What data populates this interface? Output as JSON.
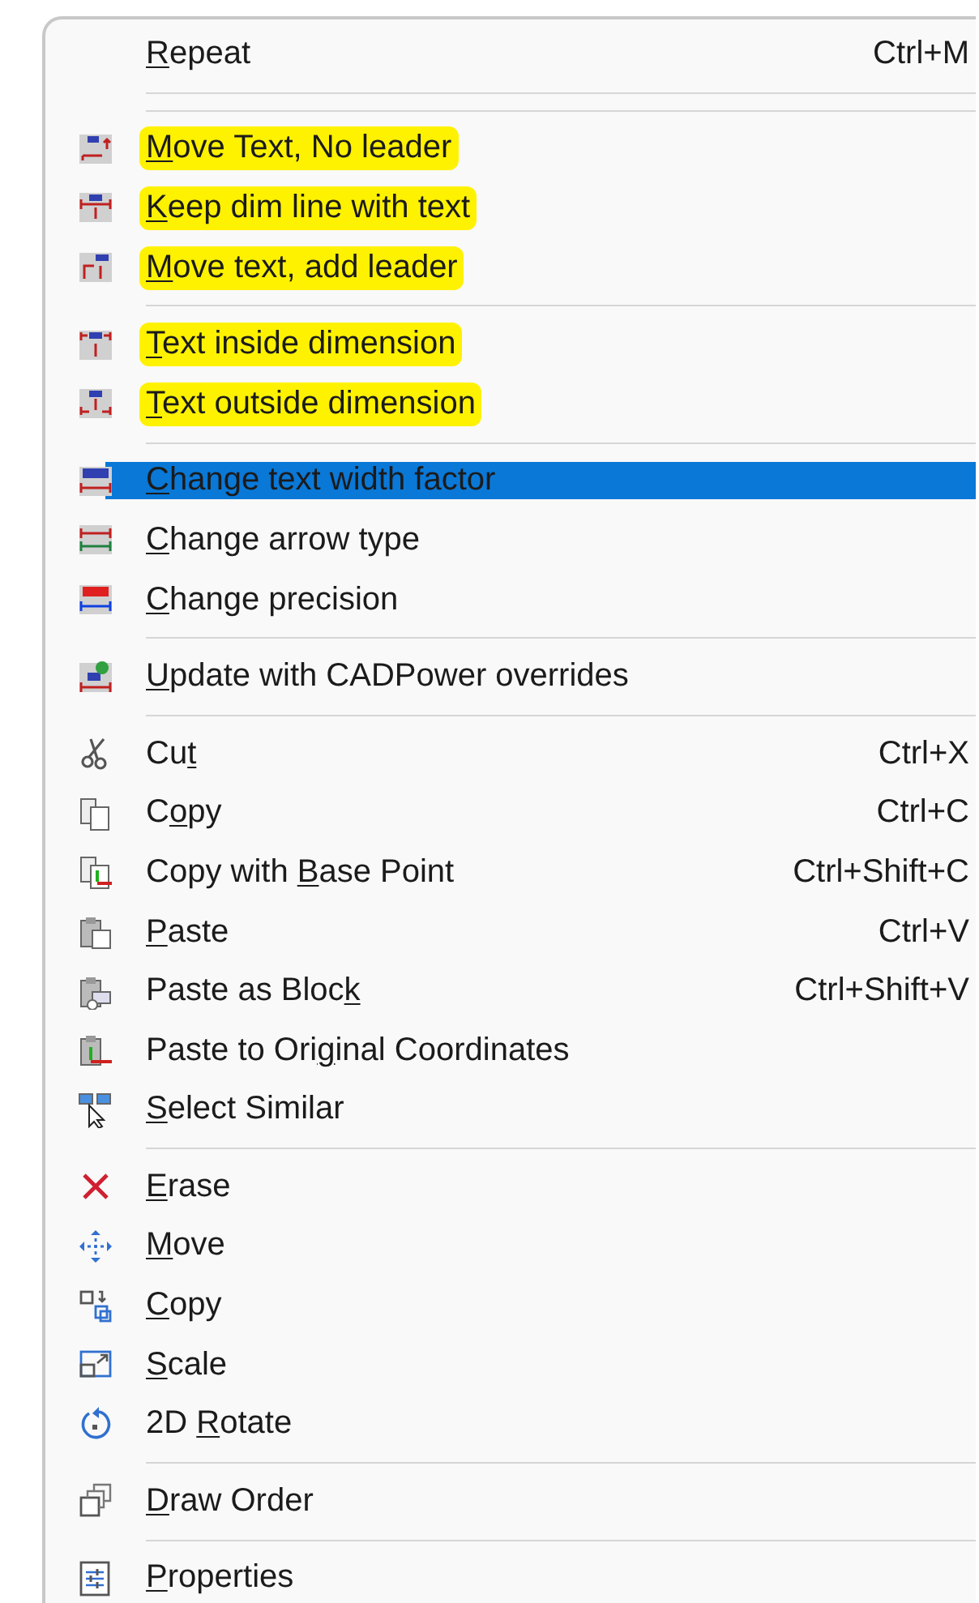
{
  "context_menu": {
    "entries": [
      {
        "kind": "item",
        "access_key": "R",
        "text_after": "epeat",
        "shortcut": "Ctrl+M",
        "highlighted": false,
        "selected": false
      },
      {
        "kind": "separator"
      },
      {
        "kind": "separator"
      },
      {
        "kind": "item",
        "access_key": "M",
        "text_after": "ove Text, No leader",
        "highlighted": true,
        "selected": false
      },
      {
        "kind": "item",
        "access_key": "K",
        "text_after": "eep dim line with text",
        "highlighted": true,
        "selected": false
      },
      {
        "kind": "item",
        "access_key": "M",
        "text_after": "ove text, add leader",
        "highlighted": true,
        "selected": false
      },
      {
        "kind": "separator"
      },
      {
        "kind": "item",
        "access_key": "T",
        "text_after": "ext inside dimension",
        "highlighted": true,
        "selected": false
      },
      {
        "kind": "item",
        "access_key": "T",
        "text_after": "ext outside dimension",
        "highlighted": true,
        "selected": false
      },
      {
        "kind": "separator"
      },
      {
        "kind": "item",
        "access_key": "C",
        "text_after": "hange text width factor",
        "highlighted": false,
        "selected": true
      },
      {
        "kind": "item",
        "access_key": "C",
        "text_after": "hange arrow type",
        "highlighted": false,
        "selected": false
      },
      {
        "kind": "item",
        "access_key": "C",
        "text_after": "hange precision",
        "highlighted": false,
        "selected": false
      },
      {
        "kind": "separator"
      },
      {
        "kind": "item",
        "access_key": "U",
        "text_after": "pdate with CADPower overrides",
        "highlighted": false,
        "selected": false
      },
      {
        "kind": "separator"
      },
      {
        "kind": "item",
        "text_before": "Cu",
        "access_key": "t",
        "shortcut": "Ctrl+X",
        "highlighted": false,
        "selected": false
      },
      {
        "kind": "item",
        "text_before": "C",
        "access_key": "o",
        "text_after": "py",
        "shortcut": "Ctrl+C",
        "highlighted": false,
        "selected": false
      },
      {
        "kind": "item",
        "text_before": "Copy with ",
        "access_key": "B",
        "text_after": "ase Point",
        "shortcut": "Ctrl+Shift+C",
        "highlighted": false,
        "selected": false
      },
      {
        "kind": "item",
        "access_key": "P",
        "text_after": "aste",
        "shortcut": "Ctrl+V",
        "highlighted": false,
        "selected": false
      },
      {
        "kind": "item",
        "text_before": "Paste as Bloc",
        "access_key": "k",
        "shortcut": "Ctrl+Shift+V",
        "highlighted": false,
        "selected": false
      },
      {
        "kind": "item",
        "text_before": "Paste to Ori",
        "access_key": "g",
        "text_after": "inal Coordinates",
        "highlighted": false,
        "selected": false
      },
      {
        "kind": "item",
        "access_key": "S",
        "text_after": "elect Similar",
        "highlighted": false,
        "selected": false
      },
      {
        "kind": "separator"
      },
      {
        "kind": "item",
        "access_key": "E",
        "text_after": "rase",
        "highlighted": false,
        "selected": false
      },
      {
        "kind": "item",
        "access_key": "M",
        "text_after": "ove",
        "highlighted": false,
        "selected": false
      },
      {
        "kind": "item",
        "access_key": "C",
        "text_after": "opy",
        "highlighted": false,
        "selected": false
      },
      {
        "kind": "item",
        "access_key": "S",
        "text_after": "cale",
        "highlighted": false,
        "selected": false
      },
      {
        "kind": "item",
        "text_before": "2D ",
        "access_key": "R",
        "text_after": "otate",
        "highlighted": false,
        "selected": false
      },
      {
        "kind": "separator"
      },
      {
        "kind": "item",
        "access_key": "D",
        "text_after": "raw Order",
        "highlighted": false,
        "selected": false
      },
      {
        "kind": "separator"
      },
      {
        "kind": "item",
        "access_key": "P",
        "text_after": "roperties",
        "highlighted": false,
        "selected": false
      }
    ]
  }
}
